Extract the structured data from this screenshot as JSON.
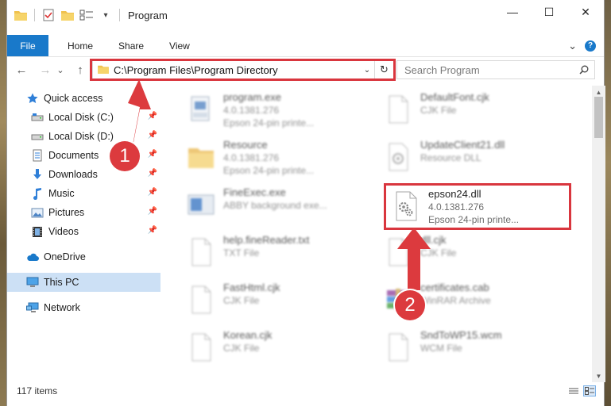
{
  "window": {
    "title": "Program",
    "controls": {
      "minimize": "—",
      "maximize": "☐",
      "close": "✕"
    }
  },
  "ribbon": {
    "tabs": [
      {
        "label": "File"
      },
      {
        "label": "Home"
      },
      {
        "label": "Share"
      },
      {
        "label": "View"
      }
    ],
    "expand_glyph": "⌄",
    "help_glyph": "?"
  },
  "address": {
    "path": "C:\\Program Files\\Program Directory",
    "dropdown_glyph": "⌄",
    "refresh_glyph": "↻"
  },
  "search": {
    "placeholder": "Search Program"
  },
  "nav": {
    "back_glyph": "←",
    "forward_glyph": "→",
    "recent_glyph": "⌄",
    "up_glyph": "↑",
    "items": [
      {
        "label": "Quick access",
        "icon": "star-icon"
      },
      {
        "label": "Local Disk (C:)",
        "icon": "drive-icon",
        "pinned": true
      },
      {
        "label": "Local Disk (D:)",
        "icon": "drive-icon",
        "pinned": true
      },
      {
        "label": "Documents",
        "icon": "documents-icon",
        "pinned": true
      },
      {
        "label": "Downloads",
        "icon": "download-icon",
        "pinned": true
      },
      {
        "label": "Music",
        "icon": "music-icon",
        "pinned": true
      },
      {
        "label": "Pictures",
        "icon": "pictures-icon",
        "pinned": true
      },
      {
        "label": "Videos",
        "icon": "videos-icon",
        "pinned": true
      },
      {
        "label": "OneDrive",
        "icon": "cloud-icon"
      },
      {
        "label": "This PC",
        "icon": "computer-icon",
        "selected": true
      },
      {
        "label": "Network",
        "icon": "network-icon"
      }
    ]
  },
  "files": [
    {
      "name": "program.exe",
      "line2": "4.0.1381.276",
      "line3": "Epson 24-pin printe...",
      "icon": "exe-icon",
      "blurred": true
    },
    {
      "name": "DefaultFont.cjk",
      "line2": "CJK File",
      "line3": "",
      "icon": "blank-file-icon",
      "blurred": true
    },
    {
      "name": "Resource",
      "line2": "4.0.1381.276",
      "line3": "Epson 24-pin printe...",
      "icon": "folder-icon",
      "blurred": true
    },
    {
      "name": "UpdateClient21.dll",
      "line2": "Resource DLL",
      "line3": "",
      "icon": "dll-icon",
      "blurred": true
    },
    {
      "name": "FineExec.exe",
      "line2": "ABBY background exe...",
      "line3": "",
      "icon": "app-icon",
      "blurred": true
    },
    {
      "name": "epson24.dll",
      "line2": "4.0.1381.276",
      "line3": "Epson 24-pin printe...",
      "icon": "dll-gear-icon",
      "blurred": false
    },
    {
      "name": "help.fineReader.txt",
      "line2": "TXT File",
      "line3": "",
      "icon": "blank-file-icon",
      "blurred": true
    },
    {
      "name": "dll.cjk",
      "line2": "CJK File",
      "line3": "",
      "icon": "blank-file-icon",
      "blurred": true
    },
    {
      "name": "FastHtml.cjk",
      "line2": "CJK File",
      "line3": "",
      "icon": "blank-file-icon",
      "blurred": true
    },
    {
      "name": "certificates.cab",
      "line2": "WinRAR Archive",
      "line3": "",
      "icon": "archive-icon",
      "blurred": true
    },
    {
      "name": "Korean.cjk",
      "line2": "CJK File",
      "line3": "",
      "icon": "blank-file-icon",
      "blurred": true
    },
    {
      "name": "SndToWP15.wcm",
      "line2": "WCM File",
      "line3": "",
      "icon": "blank-file-icon",
      "blurred": true
    }
  ],
  "status": {
    "item_count": "117 items"
  },
  "annotations": {
    "step1": "1",
    "step2": "2"
  },
  "colors": {
    "accent": "#1979ca",
    "highlight_red": "#d9363e",
    "selected_bg": "#cce0f5"
  }
}
